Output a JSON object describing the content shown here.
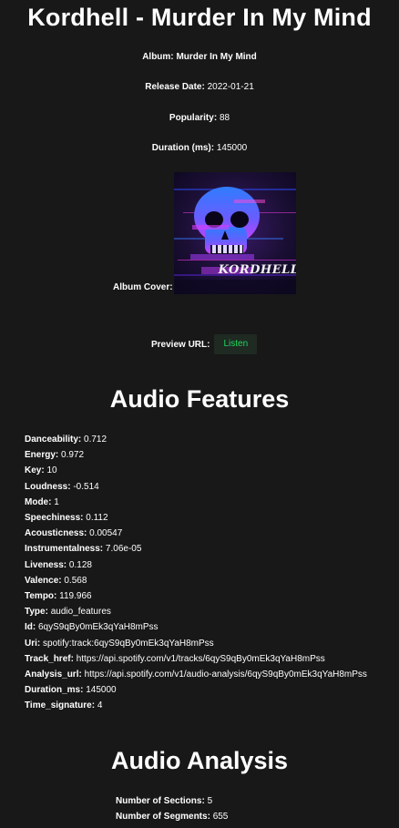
{
  "title": "Kordhell - Murder In My Mind",
  "track_info": {
    "album_label": "Album:",
    "album_value": "Murder In My Mind",
    "release_label": "Release Date:",
    "release_value": "2022-01-21",
    "popularity_label": "Popularity:",
    "popularity_value": "88",
    "duration_label": "Duration (ms):",
    "duration_value": "145000",
    "cover_label": "Album Cover:",
    "cover_text": "KORDHELL",
    "preview_label": "Preview URL:",
    "listen_label": "Listen"
  },
  "audio_features": {
    "heading": "Audio Features",
    "items": [
      {
        "key": "Danceability:",
        "value": "0.712"
      },
      {
        "key": "Energy:",
        "value": "0.972"
      },
      {
        "key": "Key:",
        "value": "10"
      },
      {
        "key": "Loudness:",
        "value": "-0.514"
      },
      {
        "key": "Mode:",
        "value": "1"
      },
      {
        "key": "Speechiness:",
        "value": "0.112"
      },
      {
        "key": "Acousticness:",
        "value": "0.00547"
      },
      {
        "key": "Instrumentalness:",
        "value": "7.06e-05"
      },
      {
        "key": "Liveness:",
        "value": "0.128"
      },
      {
        "key": "Valence:",
        "value": "0.568"
      },
      {
        "key": "Tempo:",
        "value": "119.966"
      },
      {
        "key": "Type:",
        "value": "audio_features"
      },
      {
        "key": "Id:",
        "value": "6qyS9qBy0mEk3qYaH8mPss"
      },
      {
        "key": "Uri:",
        "value": "spotify:track:6qyS9qBy0mEk3qYaH8mPss"
      },
      {
        "key": "Track_href:",
        "value": "https://api.spotify.com/v1/tracks/6qyS9qBy0mEk3qYaH8mPss"
      },
      {
        "key": "Analysis_url:",
        "value": "https://api.spotify.com/v1/audio-analysis/6qyS9qBy0mEk3qYaH8mPss"
      },
      {
        "key": "Duration_ms:",
        "value": "145000"
      },
      {
        "key": "Time_signature:",
        "value": "4"
      }
    ]
  },
  "audio_analysis": {
    "heading": "Audio Analysis",
    "sections_label": "Number of Sections:",
    "sections_value": "5",
    "segments_label": "Number of Segments:",
    "segments_value": "655"
  },
  "colors": {
    "background": "#181818",
    "text": "#ffffff",
    "listen_text": "#1ed760",
    "listen_bg": "#1f2a22"
  }
}
